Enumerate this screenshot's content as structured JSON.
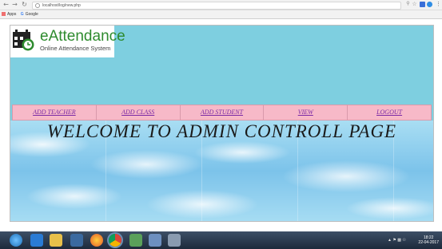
{
  "browser": {
    "url": "localhost/log/new.php",
    "bookmarks": [
      "Apps",
      "Google"
    ]
  },
  "logo": {
    "title": "eAttendance",
    "subtitle": "Online Attendance System"
  },
  "nav": {
    "items": [
      "ADD TEACHER",
      "ADD CLASS",
      "ADD STUDENT",
      "VIEW",
      "LOGOUT"
    ]
  },
  "main": {
    "heading": "WELCOME TO ADMIN CONTROLL PAGE"
  },
  "taskbar": {
    "time": "18:22",
    "date": "22-04-2017"
  }
}
